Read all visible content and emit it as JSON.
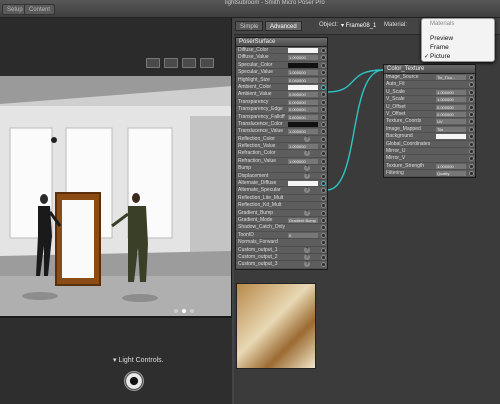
{
  "app": {
    "title": "lightsubroom - Smith Micro Poser Pro",
    "tabs": [
      "Setup",
      "Content"
    ]
  },
  "viewport": {
    "light_controls_label": "Light Controls."
  },
  "material_room": {
    "tabs": [
      "Simple",
      "Advanced"
    ],
    "active_tab": "Advanced",
    "object_label": "Object:",
    "object_value": "Frame08_1",
    "material_label": "Material:"
  },
  "materials_menu": {
    "title": "Materials",
    "items": [
      "Preview",
      "Frame",
      "Picture"
    ],
    "checked": "Picture"
  },
  "poser_surface": {
    "title": "PoserSurface",
    "rows": [
      {
        "label": "Diffuse_Color",
        "kind": "white"
      },
      {
        "label": "Diffuse_Value",
        "kind": "num",
        "value": "1.000000"
      },
      {
        "label": "Specular_Color",
        "kind": "black"
      },
      {
        "label": "Specular_Value",
        "kind": "num",
        "value": "1.000000"
      },
      {
        "label": "Highlight_Size",
        "kind": "num",
        "value": "0.040000"
      },
      {
        "label": "Ambient_Color",
        "kind": "white",
        "plug": true
      },
      {
        "label": "Ambient_Value",
        "kind": "num",
        "value": "0.500000"
      },
      {
        "label": "Transparency",
        "kind": "num",
        "value": "0.000000"
      },
      {
        "label": "Transparency_Edge",
        "kind": "num",
        "value": "0.000000"
      },
      {
        "label": "Transparency_Falloff",
        "kind": "num",
        "value": "0.600000"
      },
      {
        "label": "Translucence_Color",
        "kind": "black"
      },
      {
        "label": "Translucence_Value",
        "kind": "num",
        "value": "1.000000"
      },
      {
        "label": "Reflection_Color",
        "kind": "q"
      },
      {
        "label": "Reflection_Value",
        "kind": "num",
        "value": "1.000000"
      },
      {
        "label": "Refraction_Color",
        "kind": "q"
      },
      {
        "label": "Refraction_Value",
        "kind": "num",
        "value": "1.000000"
      },
      {
        "label": "Bump",
        "kind": "q"
      },
      {
        "label": "Displacement",
        "kind": "q"
      },
      {
        "label": "Alternate_Diffuse",
        "kind": "white",
        "plug": true
      },
      {
        "label": "Alternate_Specular",
        "kind": "q"
      },
      {
        "label": "Reflection_Lite_Mult",
        "kind": "none"
      },
      {
        "label": "Reflection_Kd_Mult",
        "kind": "none"
      },
      {
        "label": "Gradient_Bump",
        "kind": "q"
      },
      {
        "label": "Gradient_Mode",
        "kind": "text",
        "value": "Gradient Bump"
      },
      {
        "label": "Shadow_Catch_Only",
        "kind": "none"
      },
      {
        "label": "ToonID",
        "kind": "num",
        "value": "0"
      },
      {
        "label": "Normals_Forward",
        "kind": "none"
      },
      {
        "label": "Custom_output_1",
        "kind": "q"
      },
      {
        "label": "Custom_output_2",
        "kind": "q"
      },
      {
        "label": "Custom_output_3",
        "kind": "q"
      }
    ]
  },
  "color_texture": {
    "title": "Color_Texture",
    "rows": [
      {
        "label": "Image_Source",
        "kind": "text",
        "value": "Tin_Tico..."
      },
      {
        "label": "Auto_Fit",
        "kind": "none"
      },
      {
        "label": "U_Scale",
        "kind": "num",
        "value": "1.000000"
      },
      {
        "label": "V_Scale",
        "kind": "num",
        "value": "1.000000"
      },
      {
        "label": "U_Offset",
        "kind": "num",
        "value": "0.000000"
      },
      {
        "label": "V_Offset",
        "kind": "num",
        "value": "0.000000"
      },
      {
        "label": "Texture_Coords",
        "kind": "text",
        "value": "UV"
      },
      {
        "label": "Image_Mapped",
        "kind": "text",
        "value": "Tile"
      },
      {
        "label": "Background",
        "kind": "white"
      },
      {
        "label": "Global_Coordinates",
        "kind": "none"
      },
      {
        "label": "Mirror_U",
        "kind": "none"
      },
      {
        "label": "Mirror_V",
        "kind": "none"
      },
      {
        "label": "Texture_Strength",
        "kind": "num",
        "value": "1.000000"
      },
      {
        "label": "Filtering",
        "kind": "text",
        "value": "Quality"
      }
    ]
  },
  "colors": {
    "connector": "#2ec4c4",
    "menu_bg": "#f3f3f3"
  }
}
